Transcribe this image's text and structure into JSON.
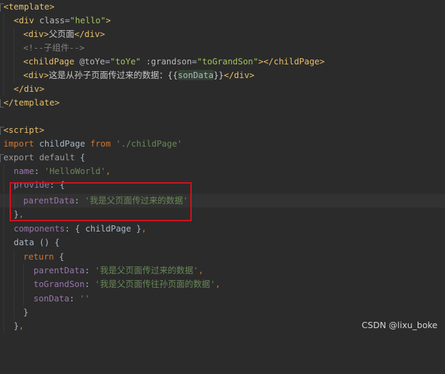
{
  "code": {
    "l1": "template",
    "l2_tag": "div",
    "l2_attr": "class",
    "l2_val": "\"hello\"",
    "l3_tag": "div",
    "l3_text": "父页面",
    "l4_comment": "<!--子组件-->",
    "l5_tag": "childPage",
    "l5_attr1": "@toYe",
    "l5_val1": "\"toYe\"",
    "l5_attr2": ":grandson",
    "l5_val2": "\"toGrandSon\"",
    "l6_tag": "div",
    "l6_text": "这是从孙子页面传过来的数据：",
    "l6_binding": "sonData",
    "l7_tag": "div",
    "l8_tag": "template",
    "l10_tag": "script",
    "l11_kw1": "import",
    "l11_id": "childPage",
    "l11_kw2": "from",
    "l11_str": "'./childPage'",
    "l12_kw1": "export",
    "l12_kw2": "default",
    "l13_prop": "name",
    "l13_str": "'HelloWorld'",
    "l14_prop": "provide",
    "l15_prop": "parentData",
    "l15_str": "'我是父页面传过来的数据'",
    "l17_prop": "components",
    "l17_id": "childPage",
    "l18_fn": "data",
    "l19_kw": "return",
    "l20_prop": "parentData",
    "l20_str": "'我是父页面传过来的数据'",
    "l21_prop": "toGrandSon",
    "l21_str": "'我是父页面传往孙页面的数据'",
    "l22_prop": "sonData",
    "l22_str": "''"
  },
  "watermark": "CSDN @lixu_boke",
  "colors": {
    "background": "#2b2b2b",
    "tag": "#e8bf6a",
    "keyword": "#cc7832",
    "string": "#6a8759",
    "property": "#9876aa",
    "highlight_box": "#d2121c"
  }
}
